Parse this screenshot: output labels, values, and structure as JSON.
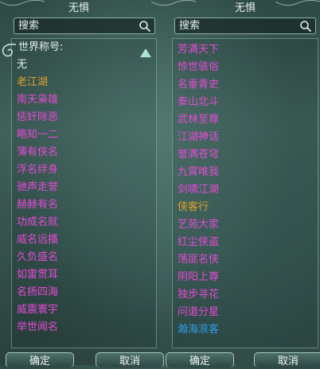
{
  "colors": {
    "magenta": "#e64ad6",
    "orange": "#e3a12a",
    "blue": "#2e9be8",
    "white": "#e8efe9"
  },
  "left": {
    "title": "无惧",
    "search_placeholder": "搜索",
    "header_label": "世界称号:",
    "items": [
      {
        "label": "无",
        "color": "white"
      },
      {
        "label": "老江湖",
        "color": "orange"
      },
      {
        "label": "南天枭雄",
        "color": "magenta"
      },
      {
        "label": "惩奸除恶",
        "color": "magenta"
      },
      {
        "label": "略知一二",
        "color": "magenta"
      },
      {
        "label": "薄有侠名",
        "color": "magenta"
      },
      {
        "label": "浮名绊身",
        "color": "magenta"
      },
      {
        "label": "驰声走誉",
        "color": "magenta"
      },
      {
        "label": "赫赫有名",
        "color": "magenta"
      },
      {
        "label": "功成名就",
        "color": "magenta"
      },
      {
        "label": "威名远播",
        "color": "magenta"
      },
      {
        "label": "久负盛名",
        "color": "magenta"
      },
      {
        "label": "如雷贯耳",
        "color": "magenta"
      },
      {
        "label": "名扬四海",
        "color": "magenta"
      },
      {
        "label": "威震寰宇",
        "color": "magenta"
      },
      {
        "label": "举世闻名",
        "color": "magenta"
      }
    ],
    "confirm_label": "确定",
    "cancel_label": "取消"
  },
  "right": {
    "title": "无惧",
    "search_placeholder": "搜索",
    "items": [
      {
        "label": "芳满天下",
        "color": "magenta"
      },
      {
        "label": "惊世骇俗",
        "color": "magenta"
      },
      {
        "label": "名垂青史",
        "color": "magenta"
      },
      {
        "label": "泰山北斗",
        "color": "magenta"
      },
      {
        "label": "武林至尊",
        "color": "magenta"
      },
      {
        "label": "江湖神话",
        "color": "magenta"
      },
      {
        "label": "誉满苍穹",
        "color": "magenta"
      },
      {
        "label": "九霄唯我",
        "color": "magenta"
      },
      {
        "label": "剑啸江湖",
        "color": "magenta"
      },
      {
        "label": "侠客行",
        "color": "orange"
      },
      {
        "label": "艺苑大家",
        "color": "magenta"
      },
      {
        "label": "红尘侠盗",
        "color": "magenta"
      },
      {
        "label": "荡匪名侠",
        "color": "magenta"
      },
      {
        "label": "阴阳上尊",
        "color": "magenta"
      },
      {
        "label": "独步寻花",
        "color": "magenta"
      },
      {
        "label": "问道分星",
        "color": "magenta"
      },
      {
        "label": "瀚海浪客",
        "color": "blue"
      }
    ],
    "confirm_label": "确定",
    "cancel_label": "取消"
  }
}
